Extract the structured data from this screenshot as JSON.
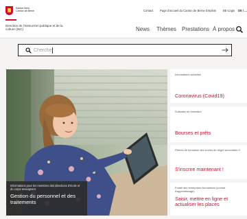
{
  "header": {
    "logo_text": "Kanton Bern\nCanton de Berne",
    "directorate": "Direction de l'instruction publique et de la culture (INC)",
    "top_links": [
      "Contact",
      "Page d'accueil du Canton de Berne",
      "Emplois",
      "BE-Login"
    ],
    "language": "DE / ...",
    "main_nav": [
      "News",
      "Thèmes",
      "Prestations",
      "À propos"
    ]
  },
  "search": {
    "placeholder": "Chercher"
  },
  "hero": {
    "caption_small": "Informations pour les membres des directions d'école et du corps enseignant",
    "caption_title": "Gestion du personnel et des traitements"
  },
  "cards": [
    {
      "kicker": "Informations actuelles",
      "title": "Coronavirus (Covid19)"
    },
    {
      "kicker": "Subsides de formation",
      "title": "Bourses et prêts"
    },
    {
      "kicker": "Filières de formation des écoles du degré secondaire II",
      "title": "S'inscrire maintenant !"
    },
    {
      "kicker": "Portail des entreprises formatrices (contrat d'apprentissage)",
      "title": "Saisir, mettre en ligne et actualiser les places"
    }
  ],
  "colors": {
    "accent": "#c8102e",
    "background": "#f5f4f2",
    "caption_bg": "#2d2d2d"
  },
  "icons": [
    "bern-logo-icon",
    "search-icon",
    "arrow-right-icon"
  ]
}
